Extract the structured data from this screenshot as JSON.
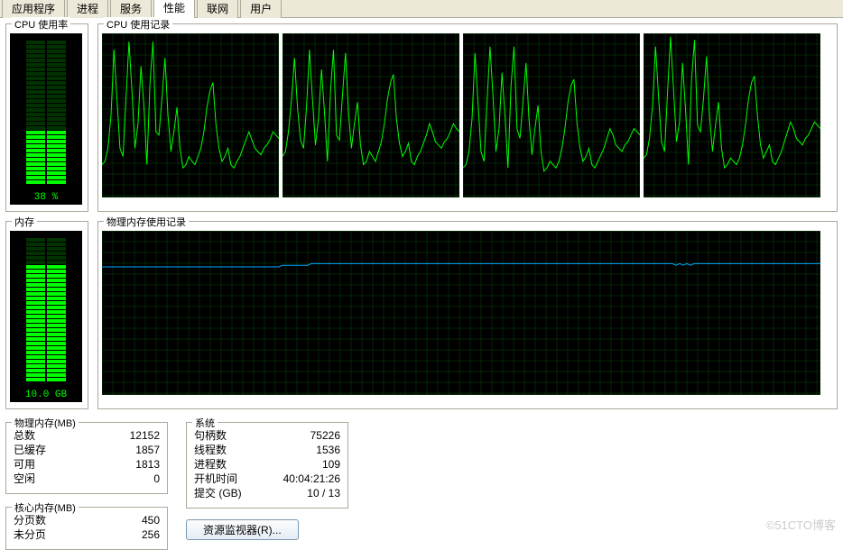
{
  "tabs": [
    "应用程序",
    "进程",
    "服务",
    "性能",
    "联网",
    "用户"
  ],
  "active_tab_index": 3,
  "cpu_gauge": {
    "title": "CPU 使用率",
    "value_label": "38 %",
    "percent": 38
  },
  "cpu_history": {
    "title": "CPU 使用记录"
  },
  "mem_gauge": {
    "title": "内存",
    "value_label": "10.0 GB",
    "percent": 82
  },
  "mem_history": {
    "title": "物理内存使用记录"
  },
  "phys_mem": {
    "title": "物理内存(MB)",
    "rows": [
      {
        "label": "总数",
        "value": "12152"
      },
      {
        "label": "已缓存",
        "value": "1857"
      },
      {
        "label": "可用",
        "value": "1813"
      },
      {
        "label": "空闲",
        "value": "0"
      }
    ]
  },
  "kernel_mem": {
    "title": "核心内存(MB)",
    "rows": [
      {
        "label": "分页数",
        "value": "450"
      },
      {
        "label": "未分页",
        "value": "256"
      }
    ]
  },
  "system": {
    "title": "系统",
    "rows": [
      {
        "label": "句柄数",
        "value": "75226"
      },
      {
        "label": "线程数",
        "value": "1536"
      },
      {
        "label": "进程数",
        "value": "109"
      },
      {
        "label": "开机时间",
        "value": "40:04:21:26"
      },
      {
        "label": "提交 (GB)",
        "value": "10 / 13"
      }
    ]
  },
  "resource_monitor_button": "资源监视器(R)...",
  "watermark": "©51CTO博客",
  "chart_data": [
    {
      "type": "line",
      "id": "cpu_core0",
      "title": "",
      "xlabel": "",
      "ylabel": "",
      "ylim": [
        0,
        100
      ],
      "xlim": [
        0,
        60
      ],
      "color": "#00ff00",
      "background": "#000",
      "values": [
        20,
        22,
        30,
        50,
        90,
        60,
        30,
        25,
        60,
        95,
        65,
        30,
        45,
        80,
        55,
        20,
        70,
        95,
        40,
        38,
        60,
        85,
        50,
        28,
        40,
        55,
        30,
        18,
        20,
        25,
        22,
        20,
        25,
        30,
        40,
        55,
        65,
        70,
        45,
        30,
        22,
        25,
        30,
        20,
        18,
        22,
        25,
        30,
        35,
        40,
        35,
        30,
        28,
        26,
        30,
        32,
        35,
        40,
        38,
        36
      ]
    },
    {
      "type": "line",
      "id": "cpu_core1",
      "title": "",
      "xlabel": "",
      "ylabel": "",
      "ylim": [
        0,
        100
      ],
      "xlim": [
        0,
        60
      ],
      "color": "#00ff00",
      "background": "#000",
      "values": [
        25,
        28,
        40,
        60,
        85,
        55,
        35,
        30,
        55,
        90,
        60,
        32,
        48,
        78,
        52,
        22,
        65,
        90,
        38,
        35,
        62,
        88,
        52,
        30,
        45,
        58,
        32,
        20,
        22,
        28,
        25,
        22,
        28,
        34,
        45,
        60,
        70,
        75,
        48,
        33,
        25,
        28,
        33,
        22,
        20,
        25,
        28,
        33,
        38,
        45,
        40,
        34,
        32,
        30,
        34,
        36,
        40,
        45,
        42,
        40
      ]
    },
    {
      "type": "line",
      "id": "cpu_core2",
      "title": "",
      "xlabel": "",
      "ylabel": "",
      "ylim": [
        0,
        100
      ],
      "xlim": [
        0,
        60
      ],
      "color": "#00ff00",
      "background": "#000",
      "values": [
        18,
        20,
        28,
        48,
        88,
        58,
        28,
        22,
        58,
        92,
        62,
        28,
        42,
        76,
        50,
        18,
        68,
        92,
        42,
        36,
        58,
        82,
        48,
        26,
        42,
        56,
        28,
        16,
        18,
        22,
        20,
        18,
        22,
        30,
        42,
        58,
        68,
        72,
        46,
        30,
        22,
        25,
        30,
        20,
        18,
        22,
        26,
        30,
        36,
        42,
        38,
        32,
        30,
        28,
        32,
        34,
        38,
        42,
        40,
        38
      ]
    },
    {
      "type": "line",
      "id": "cpu_core3",
      "title": "",
      "xlabel": "",
      "ylabel": "",
      "ylim": [
        0,
        100
      ],
      "xlim": [
        0,
        60
      ],
      "color": "#00ff00",
      "background": "#000",
      "values": [
        24,
        26,
        36,
        56,
        92,
        62,
        34,
        28,
        64,
        98,
        66,
        34,
        46,
        82,
        54,
        20,
        72,
        96,
        44,
        40,
        60,
        86,
        50,
        28,
        44,
        58,
        30,
        18,
        20,
        24,
        22,
        20,
        24,
        32,
        44,
        60,
        70,
        74,
        50,
        32,
        24,
        28,
        32,
        22,
        20,
        24,
        28,
        34,
        40,
        46,
        42,
        36,
        34,
        32,
        36,
        38,
        42,
        46,
        44,
        42
      ]
    },
    {
      "type": "line",
      "id": "physical_memory_usage",
      "title": "",
      "xlabel": "",
      "ylabel": "",
      "ylim": [
        0,
        100
      ],
      "xlim": [
        0,
        200
      ],
      "color": "#00a8ff",
      "background": "#000",
      "values": [
        78,
        78,
        78,
        78,
        78,
        78,
        78,
        78,
        78,
        78,
        78,
        78,
        78,
        78,
        78,
        78,
        78,
        78,
        78,
        78,
        78,
        78,
        78,
        78,
        78,
        78,
        78,
        78,
        78,
        78,
        78,
        78,
        78,
        78,
        78,
        78,
        78,
        78,
        78,
        78,
        78,
        78,
        78,
        78,
        78,
        78,
        78,
        78,
        78,
        78,
        79,
        79,
        79,
        79,
        79,
        79,
        79,
        79,
        80,
        80,
        80,
        80,
        80,
        80,
        80,
        80,
        80,
        80,
        80,
        80,
        80,
        80,
        80,
        80,
        80,
        80,
        80,
        80,
        80,
        80,
        80,
        80,
        80,
        80,
        80,
        80,
        80,
        80,
        80,
        80,
        80,
        80,
        80,
        80,
        80,
        80,
        80,
        80,
        80,
        80,
        80,
        80,
        80,
        80,
        80,
        80,
        80,
        80,
        80,
        80,
        80,
        80,
        80,
        80,
        80,
        80,
        80,
        80,
        80,
        80,
        80,
        80,
        80,
        80,
        80,
        80,
        80,
        80,
        80,
        80,
        80,
        80,
        80,
        80,
        80,
        80,
        80,
        80,
        80,
        80,
        80,
        80,
        80,
        80,
        80,
        80,
        80,
        80,
        80,
        80,
        80,
        80,
        80,
        80,
        80,
        80,
        80,
        80,
        80,
        79,
        80,
        79,
        80,
        79,
        80,
        80,
        80,
        80,
        80,
        80,
        80,
        80,
        80,
        80,
        80,
        80,
        80,
        80,
        80,
        80,
        80,
        80,
        80,
        80,
        80,
        80,
        80,
        80,
        80,
        80,
        80,
        80,
        80,
        80,
        80,
        80,
        80,
        80,
        80,
        80
      ]
    }
  ]
}
